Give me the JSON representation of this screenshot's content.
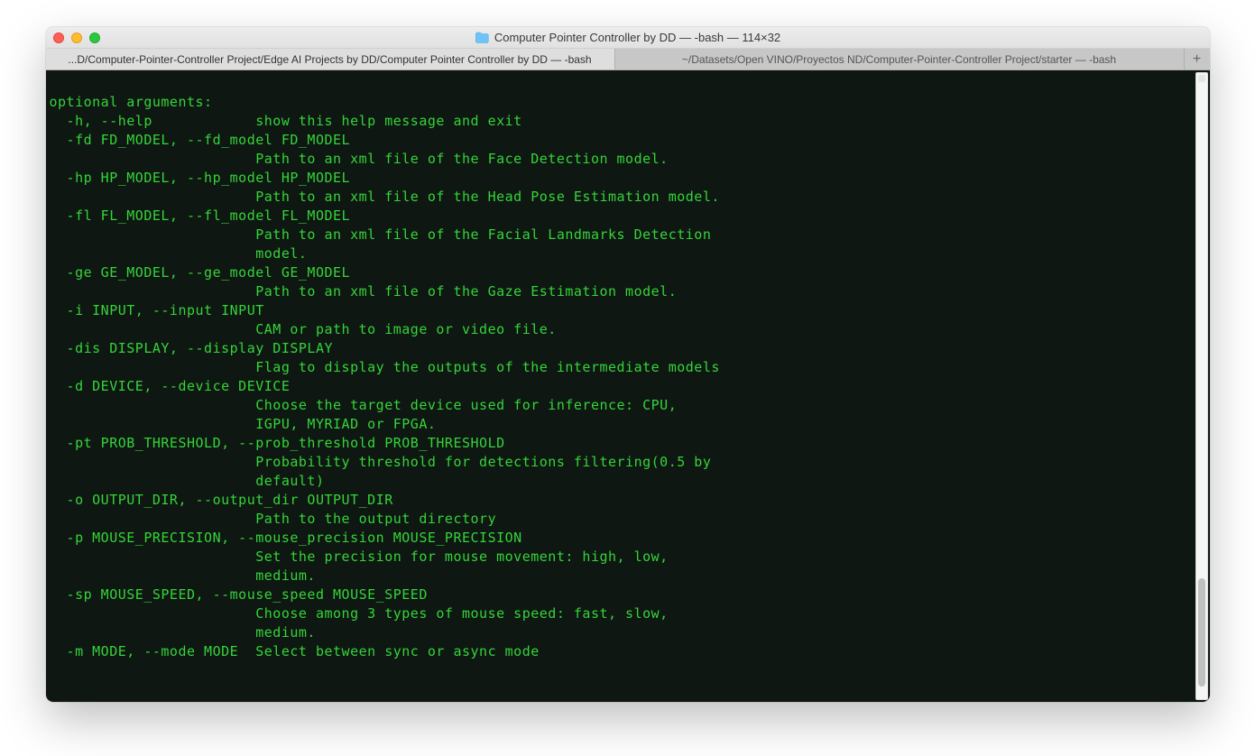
{
  "window": {
    "title": "Computer Pointer Controller by DD — -bash — 114×32"
  },
  "tabs": [
    {
      "label": "...D/Computer-Pointer-Controller Project/Edge AI Projects by DD/Computer Pointer Controller by DD — -bash",
      "active": true
    },
    {
      "label": "~/Datasets/Open VINO/Proyectos ND/Computer-Pointer-Controller Project/starter — -bash",
      "active": false
    }
  ],
  "terminal_text": "\noptional arguments:\n  -h, --help            show this help message and exit\n  -fd FD_MODEL, --fd_model FD_MODEL\n                        Path to an xml file of the Face Detection model.\n  -hp HP_MODEL, --hp_model HP_MODEL\n                        Path to an xml file of the Head Pose Estimation model.\n  -fl FL_MODEL, --fl_model FL_MODEL\n                        Path to an xml file of the Facial Landmarks Detection\n                        model.\n  -ge GE_MODEL, --ge_model GE_MODEL\n                        Path to an xml file of the Gaze Estimation model.\n  -i INPUT, --input INPUT\n                        CAM or path to image or video file.\n  -dis DISPLAY, --display DISPLAY\n                        Flag to display the outputs of the intermediate models\n  -d DEVICE, --device DEVICE\n                        Choose the target device used for inference: CPU,\n                        IGPU, MYRIAD or FPGA.\n  -pt PROB_THRESHOLD, --prob_threshold PROB_THRESHOLD\n                        Probability threshold for detections filtering(0.5 by\n                        default)\n  -o OUTPUT_DIR, --output_dir OUTPUT_DIR\n                        Path to the output directory\n  -p MOUSE_PRECISION, --mouse_precision MOUSE_PRECISION\n                        Set the precision for mouse movement: high, low,\n                        medium.\n  -sp MOUSE_SPEED, --mouse_speed MOUSE_SPEED\n                        Choose among 3 types of mouse speed: fast, slow,\n                        medium.\n  -m MODE, --mode MODE  Select between sync or async mode",
  "colors": {
    "terminal_bg": "#0e1711",
    "terminal_fg": "#35d43a"
  },
  "add_tab_label": "+"
}
